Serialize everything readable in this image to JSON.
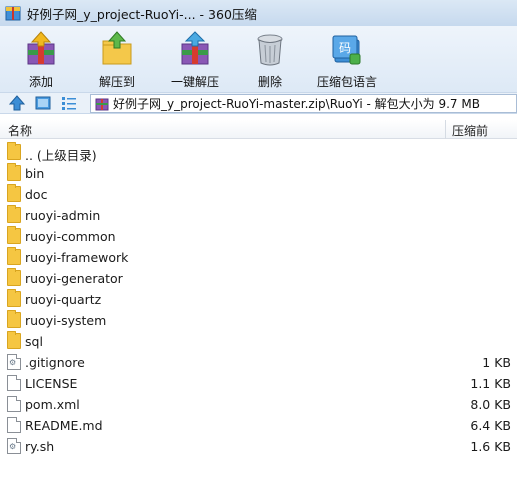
{
  "window": {
    "title": "好例子网_y_project-RuoYi-... - 360压缩"
  },
  "toolbar": {
    "add_label": "添加",
    "extract_to_label": "解压到",
    "one_click_extract_label": "一键解压",
    "delete_label": "删除",
    "encoding_label": "压缩包语言"
  },
  "address": {
    "path": "好例子网_y_project-RuoYi-master.zip\\RuoYi - 解包大小为 9.7 MB"
  },
  "columns": {
    "name": "名称",
    "compressed": "压缩前"
  },
  "files": [
    {
      "name": ".. (上级目录)",
      "size": "",
      "type": "folder"
    },
    {
      "name": "bin",
      "size": "",
      "type": "folder"
    },
    {
      "name": "doc",
      "size": "",
      "type": "folder"
    },
    {
      "name": "ruoyi-admin",
      "size": "",
      "type": "folder"
    },
    {
      "name": "ruoyi-common",
      "size": "",
      "type": "folder"
    },
    {
      "name": "ruoyi-framework",
      "size": "",
      "type": "folder"
    },
    {
      "name": "ruoyi-generator",
      "size": "",
      "type": "folder"
    },
    {
      "name": "ruoyi-quartz",
      "size": "",
      "type": "folder"
    },
    {
      "name": "ruoyi-system",
      "size": "",
      "type": "folder"
    },
    {
      "name": "sql",
      "size": "",
      "type": "folder"
    },
    {
      "name": ".gitignore",
      "size": "1 KB",
      "type": "file"
    },
    {
      "name": "LICENSE",
      "size": "1.1 KB",
      "type": "file"
    },
    {
      "name": "pom.xml",
      "size": "8.0 KB",
      "type": "file"
    },
    {
      "name": "README.md",
      "size": "6.4 KB",
      "type": "file"
    },
    {
      "name": "ry.sh",
      "size": "1.6 KB",
      "type": "script"
    }
  ]
}
